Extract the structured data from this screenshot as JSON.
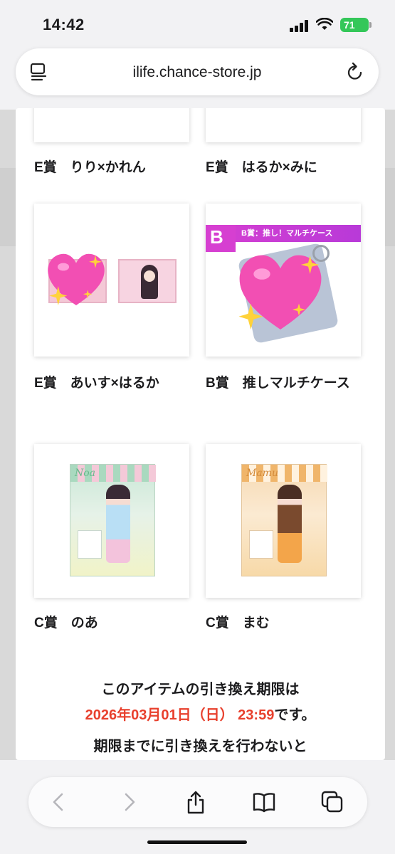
{
  "status_bar": {
    "time": "14:42",
    "battery": "71"
  },
  "browser": {
    "url": "ilife.chance-store.jp"
  },
  "items": [
    {
      "caption": "E賞　りり×かれん"
    },
    {
      "caption": "E賞　はるか×みに"
    },
    {
      "caption": "E賞　あいす×はるか"
    },
    {
      "caption": "B賞　推しマルチケース"
    },
    {
      "caption": "C賞　のあ"
    },
    {
      "caption": "C賞　まむ"
    }
  ],
  "images": {
    "b_badge": "B",
    "b_banner": "B賞：推し！マルチケース",
    "noa_name": "Noa",
    "mamu_name": "Mamu"
  },
  "notice": {
    "line1": "このアイテムの引き換え期限は",
    "deadline": "2026年03月01日（日） 23:59",
    "line2_suffix": "です。",
    "line3": "期限までに引き換えを行わないと"
  },
  "colors": {
    "accent_red": "#e8402d",
    "badge_magenta": "#d63fd1",
    "battery_green": "#34c759"
  }
}
